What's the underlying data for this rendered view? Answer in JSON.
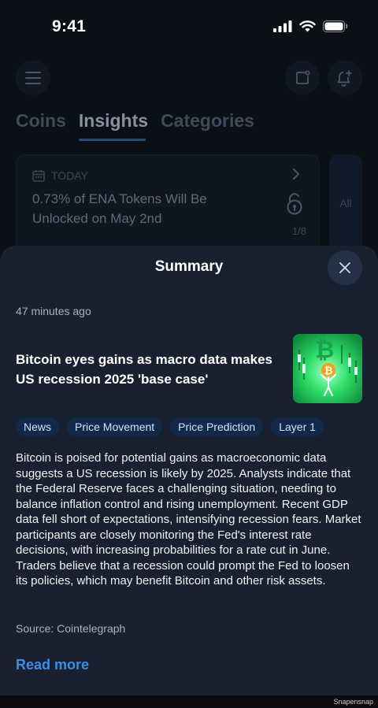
{
  "status_bar": {
    "time": "9:41"
  },
  "header": {
    "menu_icon": "hamburger-menu-icon",
    "bookmark_icon": "bookmark-badge-icon",
    "bell_icon": "notification-bell-add-icon"
  },
  "tabs": [
    {
      "label": "Coins",
      "active": false
    },
    {
      "label": "Insights",
      "active": true
    },
    {
      "label": "Categories",
      "active": false
    }
  ],
  "insight_card": {
    "date_label": "TODAY",
    "title": "0.73% of ENA Tokens Will Be Unlocked on May 2nd",
    "count": "1/8",
    "all_label": "All"
  },
  "sheet": {
    "title": "Summary",
    "timestamp": "47 minutes ago",
    "headline": "Bitcoin eyes gains as macro data makes US recession 2025 'base case'",
    "tags": [
      "News",
      "Price Movement",
      "Price Prediction",
      "Layer 1"
    ],
    "body": "Bitcoin is poised for potential gains as macroeconomic data suggests a US recession is likely by 2025. Analysts indicate that the Federal Reserve faces a challenging situation, needing to balance inflation control and rising unemployment. Recent GDP data fell short of expectations, intensifying recession fears. Market participants are closely monitoring the Fed's interest rate decisions, with increasing probabilities for a rate cut in June. Traders believe that a recession could prompt the Fed to loosen its policies, which may benefit Bitcoin and other risk assets.",
    "source": "Source: Cointelegraph",
    "read_more": "Read more"
  },
  "watermark": "Snapensnap",
  "colors": {
    "background": "#0b0f16",
    "sheet": "#192131",
    "tag_bg": "#12294a",
    "link": "#3b8de6",
    "thumb_green": "#2fe06b"
  }
}
